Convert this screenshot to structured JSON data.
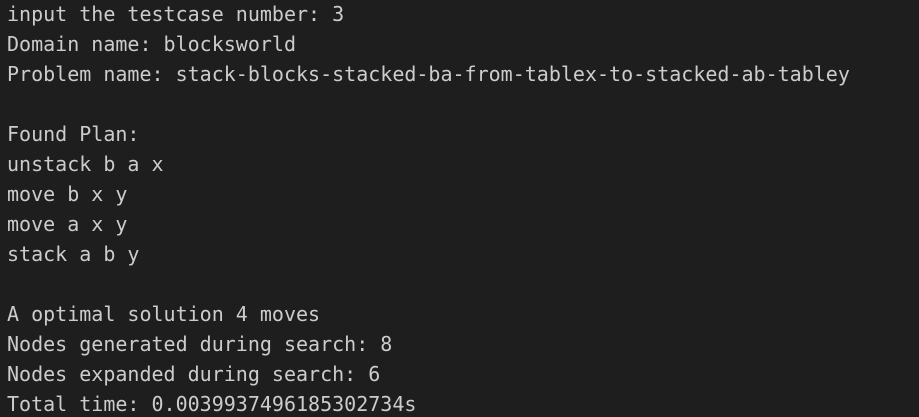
{
  "terminal": {
    "header": [
      "input the testcase number: 3",
      "Domain name: blocksworld",
      "Problem name: stack-blocks-stacked-ba-from-tablex-to-stacked-ab-tabley"
    ],
    "plan_title": "Found Plan:",
    "plan_steps": [
      "unstack b a x",
      "move b x y",
      "move a x y",
      "stack a b y"
    ],
    "summary": [
      "A optimal solution 4 moves",
      "Nodes generated during search: 8",
      "Nodes expanded during search: 6",
      "Total time: 0.0039937496185302734s"
    ]
  },
  "colors": {
    "background": "#1e1e1e",
    "text": "#cccccc"
  }
}
